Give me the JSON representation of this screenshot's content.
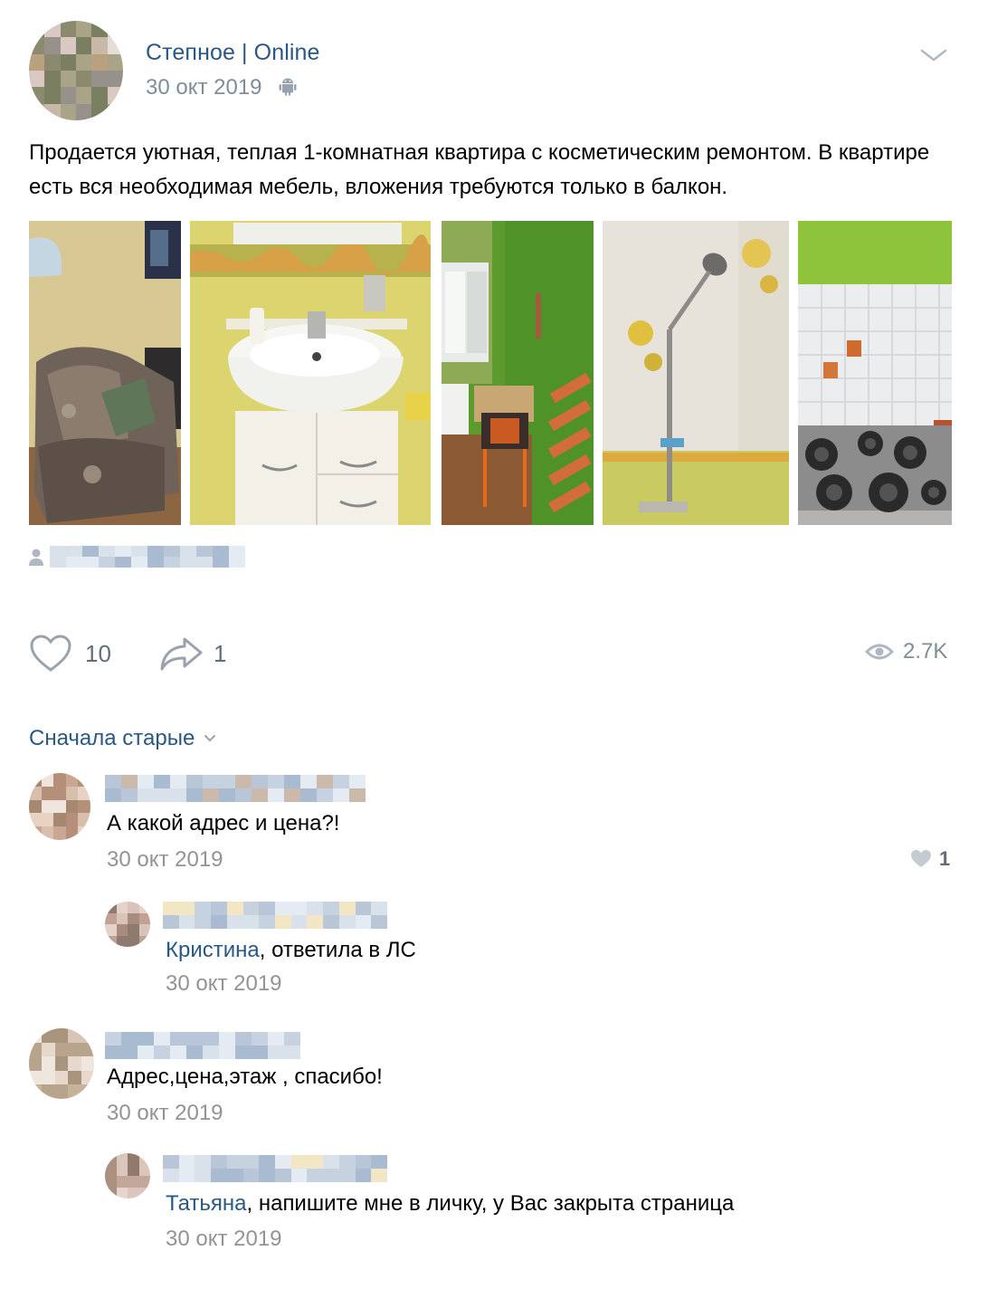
{
  "post": {
    "author": "Степное | Online",
    "date": "30 окт 2019",
    "platform_icon": "android-icon",
    "text": "Продается уютная, теплая 1-комнатная квартира с косметическим ремонтом. В квартире есть вся необходимая мебель, вложения требуются только в балкон."
  },
  "actions": {
    "likes": "10",
    "shares": "1",
    "views": "2.7K"
  },
  "comments_sort": "Сначала старые",
  "comments": [
    {
      "text": "А какой адрес и цена?!",
      "date": "30 окт 2019",
      "likes": "1"
    },
    {
      "mention": "Кристина",
      "text": ", ответила в ЛС",
      "date": "30 окт 2019"
    },
    {
      "text": "Адрес,цена,этаж , спасибо!",
      "date": "30 окт 2019"
    },
    {
      "mention": "Татьяна",
      "text": ", напишите мне в личку, у Вас закрыта страница",
      "date": "30 окт 2019"
    }
  ],
  "colors": {
    "link": "#2a5885",
    "secondary": "#818c99",
    "icon": "#99a2ad"
  }
}
